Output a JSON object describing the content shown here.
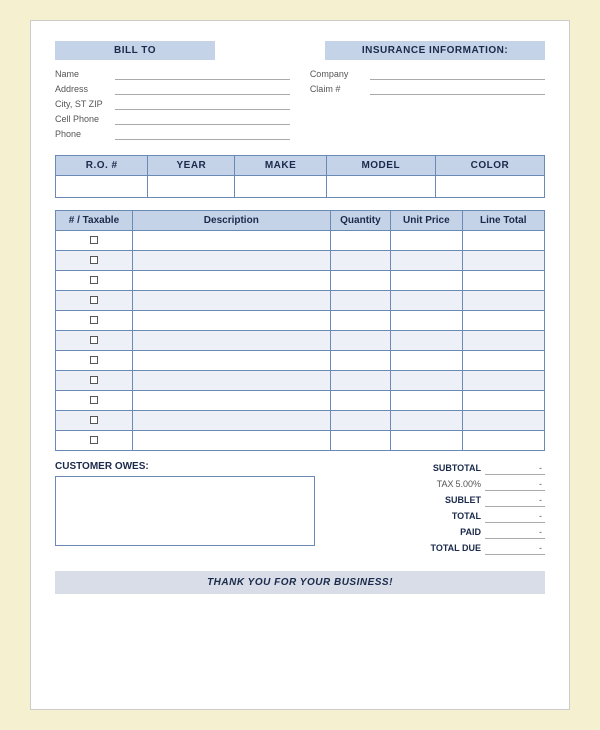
{
  "header": {
    "bill_to_label": "BILL TO",
    "insurance_label": "INSURANCE INFORMATION:"
  },
  "bill_to_fields": [
    {
      "label": "Name",
      "value": ""
    },
    {
      "label": "Address",
      "value": ""
    },
    {
      "label": "City, ST ZIP",
      "value": ""
    },
    {
      "label": "Cell Phone",
      "value": ""
    },
    {
      "label": "Phone",
      "value": ""
    }
  ],
  "insurance_fields": [
    {
      "label": "Company",
      "value": ""
    },
    {
      "label": "Claim #",
      "value": ""
    }
  ],
  "vehicle_headers": [
    "R.O. #",
    "YEAR",
    "MAKE",
    "MODEL",
    "COLOR"
  ],
  "items_headers": [
    "# / Taxable",
    "Description",
    "Quantity",
    "Unit Price",
    "Line Total"
  ],
  "line_items": [
    {
      "num": "",
      "desc": "",
      "qty": "",
      "unit": "",
      "total": ""
    },
    {
      "num": "",
      "desc": "",
      "qty": "",
      "unit": "",
      "total": ""
    },
    {
      "num": "",
      "desc": "",
      "qty": "",
      "unit": "",
      "total": ""
    },
    {
      "num": "",
      "desc": "",
      "qty": "",
      "unit": "",
      "total": ""
    },
    {
      "num": "",
      "desc": "",
      "qty": "",
      "unit": "",
      "total": ""
    },
    {
      "num": "",
      "desc": "",
      "qty": "",
      "unit": "",
      "total": ""
    },
    {
      "num": "",
      "desc": "",
      "qty": "",
      "unit": "",
      "total": ""
    },
    {
      "num": "",
      "desc": "",
      "qty": "",
      "unit": "",
      "total": ""
    },
    {
      "num": "",
      "desc": "",
      "qty": "",
      "unit": "",
      "total": ""
    },
    {
      "num": "",
      "desc": "",
      "qty": "",
      "unit": "",
      "total": ""
    },
    {
      "num": "",
      "desc": "",
      "qty": "",
      "unit": "",
      "total": ""
    }
  ],
  "totals": {
    "subtotal_label": "SUBTOTAL",
    "tax_label": "TAX",
    "tax_rate": "5.00%",
    "sublet_label": "SUBLET",
    "total_label": "TOTAL",
    "paid_label": "PAID",
    "total_due_label": "TOTAL DUE",
    "subtotal_value": "-",
    "sublet_value": "-",
    "total_value": "-",
    "paid_value": "-",
    "total_due_value": "-",
    "tax_value": "-"
  },
  "customer_owes": {
    "label": "CUSTOMER OWES:"
  },
  "footer": {
    "text": "THANK YOU FOR YOUR BUSINESS!"
  }
}
